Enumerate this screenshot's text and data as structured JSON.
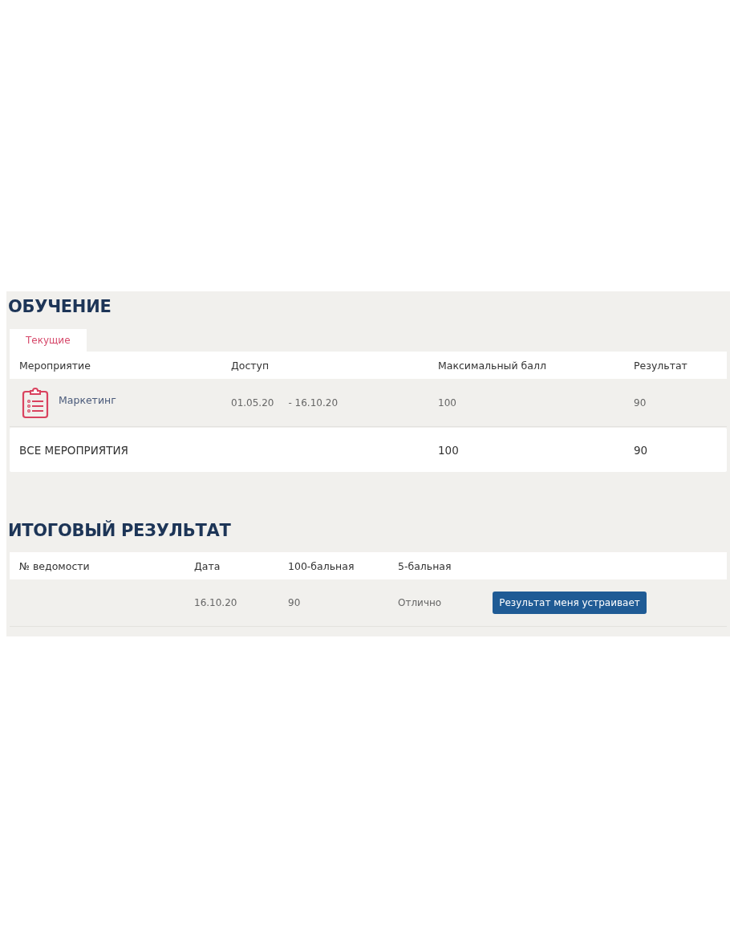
{
  "training": {
    "title": "ОБУЧЕНИЕ",
    "tabs": [
      {
        "label": "Текущие",
        "selected": true
      }
    ],
    "table": {
      "columns": [
        "Мероприятие",
        "Доступ",
        "Максимальный балл",
        "Результат"
      ],
      "rows": [
        {
          "event": "Маркетинг",
          "access_from": "01.05.20",
          "access_to": "- 16.10.20",
          "max_score": "100",
          "result": "90"
        }
      ],
      "total": {
        "label": "ВСЕ МЕРОПРИЯТИЯ",
        "max_score": "100",
        "result": "90"
      }
    }
  },
  "final_result": {
    "title": "ИТОГОВЫЙ РЕЗУЛЬТАТ",
    "table": {
      "columns": [
        "№ ведомости",
        "Дата",
        "100-бальная",
        "5-бальная"
      ],
      "rows": [
        {
          "date": "16.10.20",
          "score_100": "90",
          "score_5": "Отлично",
          "button": "Результат меня устраивает"
        }
      ]
    }
  }
}
